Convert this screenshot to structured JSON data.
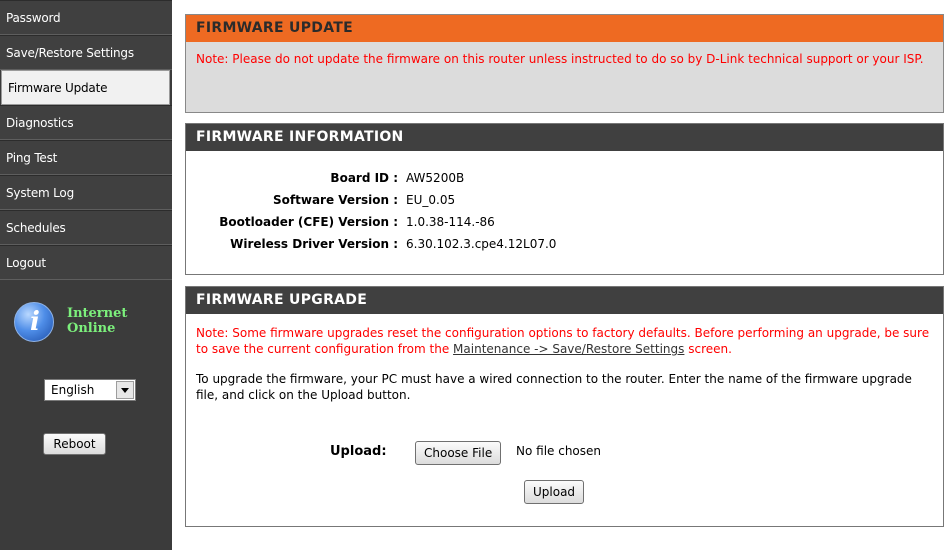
{
  "sidebar": {
    "items": [
      {
        "label": "Password"
      },
      {
        "label": "Save/Restore Settings"
      },
      {
        "label": "Firmware Update",
        "active": true
      },
      {
        "label": "Diagnostics"
      },
      {
        "label": "Ping Test"
      },
      {
        "label": "System Log"
      },
      {
        "label": "Schedules"
      },
      {
        "label": "Logout"
      }
    ],
    "status": {
      "line1": "Internet",
      "line2": "Online",
      "icon": "internet-status-globe-icon"
    },
    "language": {
      "selected": "English"
    },
    "reboot_label": "Reboot"
  },
  "firmware_update": {
    "title": "FIRMWARE UPDATE",
    "note": "Note: Please do not update the firmware on this router unless instructed to do so by D-Link technical support or your ISP."
  },
  "firmware_info": {
    "title": "FIRMWARE INFORMATION",
    "rows": [
      {
        "label": "Board ID :",
        "value": "AW5200B"
      },
      {
        "label": "Software Version :",
        "value": "EU_0.05"
      },
      {
        "label": "Bootloader (CFE) Version :",
        "value": "1.0.38-114.-86"
      },
      {
        "label": "Wireless Driver Version :",
        "value": "6.30.102.3.cpe4.12L07.0"
      }
    ]
  },
  "firmware_upgrade": {
    "title": "FIRMWARE UPGRADE",
    "note_before_link": "Note: Some firmware upgrades reset the configuration options to factory defaults. Before performing an upgrade, be sure to save the current configuration from the ",
    "note_link": "Maintenance -> Save/Restore Settings",
    "note_after_link": " screen.",
    "instructions": "To upgrade the firmware, your PC must have a wired connection to the router. Enter the name of the firmware upgrade file, and click on the Upload button.",
    "upload_label": "Upload:",
    "choose_file_label": "Choose File",
    "file_status": "No file chosen",
    "upload_button_label": "Upload"
  },
  "colors": {
    "accent_orange": "#ee6a22",
    "header_dark": "#404040",
    "note_red": "#ff0000",
    "status_green": "#7cf07c"
  }
}
